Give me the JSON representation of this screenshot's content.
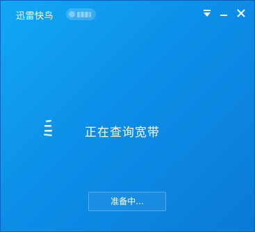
{
  "window": {
    "title": "迅雷快鸟"
  },
  "titlebar": {
    "menu_icon": "dropdown-menu-icon",
    "minimize_icon": "minimize-icon",
    "close_icon": "close-icon"
  },
  "main": {
    "status_text": "正在查询宽带",
    "spinner_icon": "loading-spinner-icon"
  },
  "footer": {
    "button_label": "准备中..."
  },
  "colors": {
    "background": "#0c8fe8",
    "text": "#ffffff"
  }
}
